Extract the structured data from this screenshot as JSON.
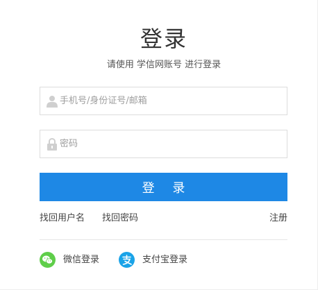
{
  "login": {
    "title": "登录",
    "subtitle": "请使用 学信网账号 进行登录",
    "username_placeholder": "手机号/身份证号/邮箱",
    "password_placeholder": "密码",
    "submit_label": "登 录"
  },
  "links": {
    "forgot_username": "找回用户名",
    "forgot_password": "找回密码",
    "register": "注册"
  },
  "social": {
    "wechat_label": "微信登录",
    "alipay_label": "支付宝登录"
  },
  "colors": {
    "primary": "#1e88e5",
    "wechat": "#5fce4a",
    "alipay": "#1aa3e8"
  }
}
